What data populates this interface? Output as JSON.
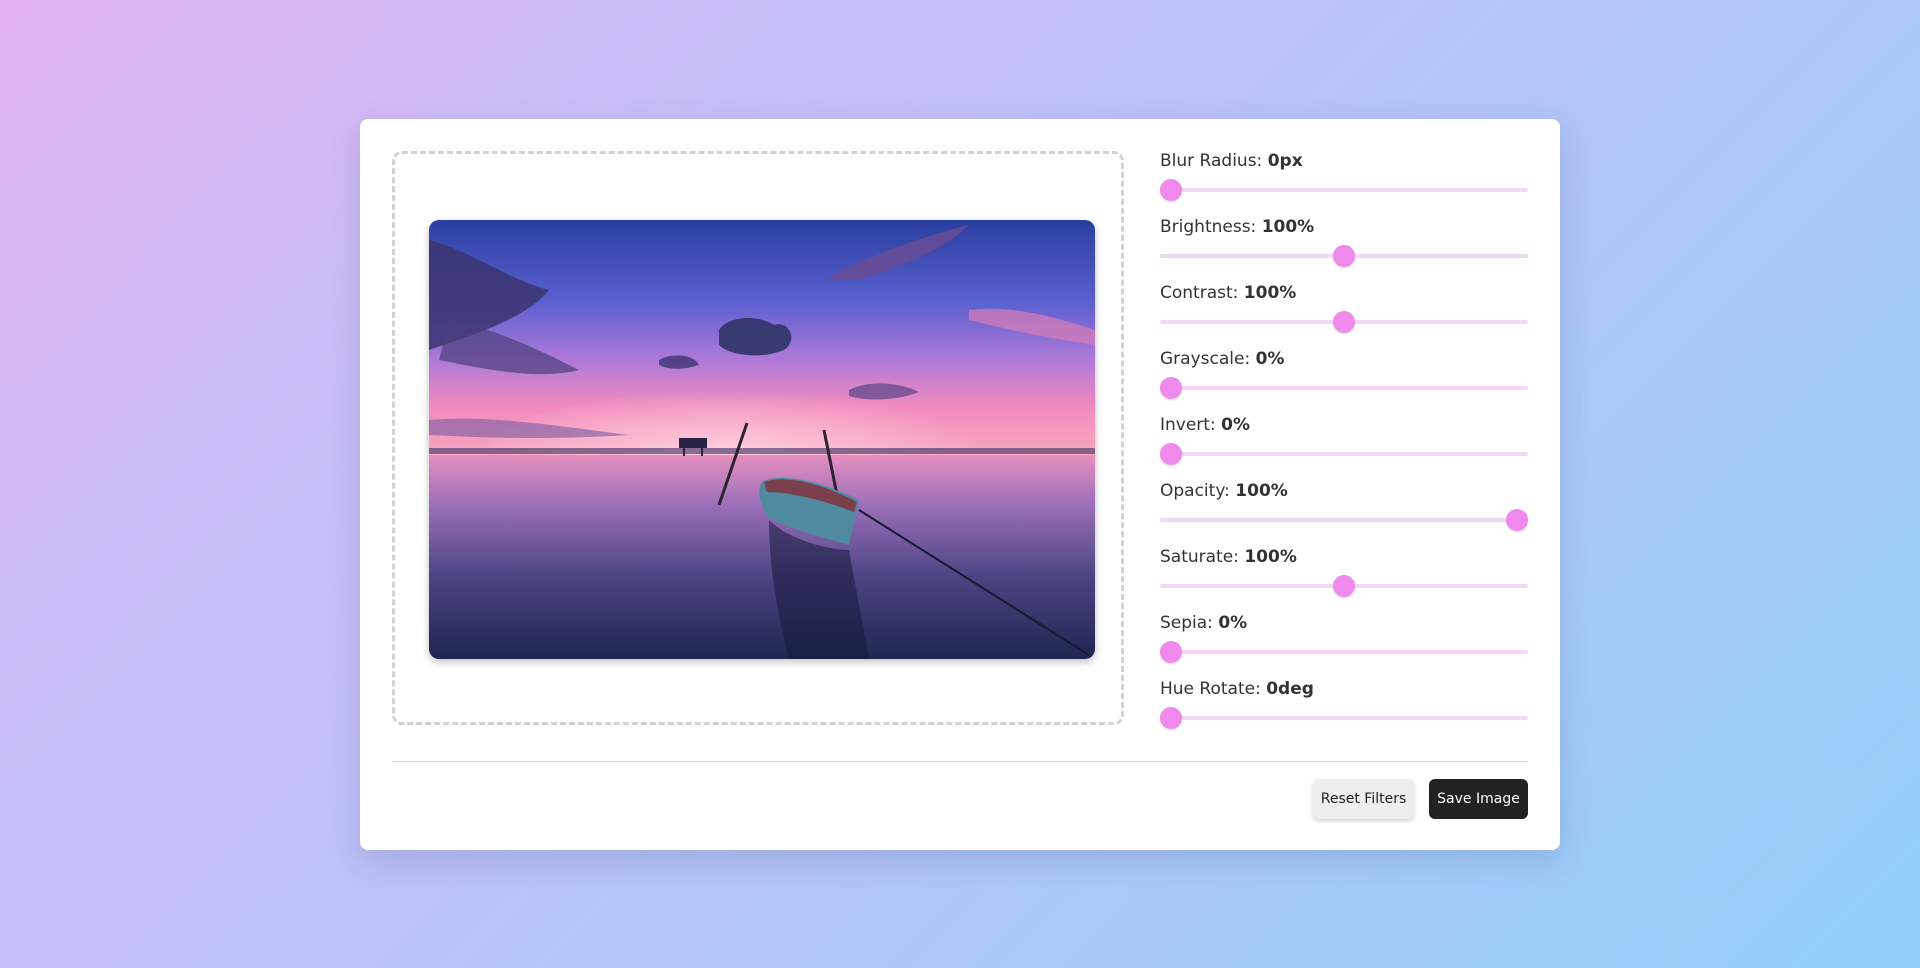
{
  "preview": {
    "image_alt": "Boat on calm water at sunset"
  },
  "filters": [
    {
      "label": "Blur Radius:",
      "value": "0px",
      "level": 0.0
    },
    {
      "label": "Brightness:",
      "value": "100%",
      "level": 0.5
    },
    {
      "label": "Contrast:",
      "value": "100%",
      "level": 0.5
    },
    {
      "label": "Grayscale:",
      "value": "0%",
      "level": 0.0
    },
    {
      "label": "Invert:",
      "value": "0%",
      "level": 0.0
    },
    {
      "label": "Opacity:",
      "value": "100%",
      "level": 1.0
    },
    {
      "label": "Saturate:",
      "value": "100%",
      "level": 0.5
    },
    {
      "label": "Sepia:",
      "value": "0%",
      "level": 0.0
    },
    {
      "label": "Hue Rotate:",
      "value": "0deg",
      "level": 0.0
    }
  ],
  "actions": {
    "reset_label": "Reset Filters",
    "save_label": "Save Image"
  },
  "colors": {
    "accent": "#ef89ec",
    "track": "#f2d8f6",
    "save_button": "#222222"
  }
}
